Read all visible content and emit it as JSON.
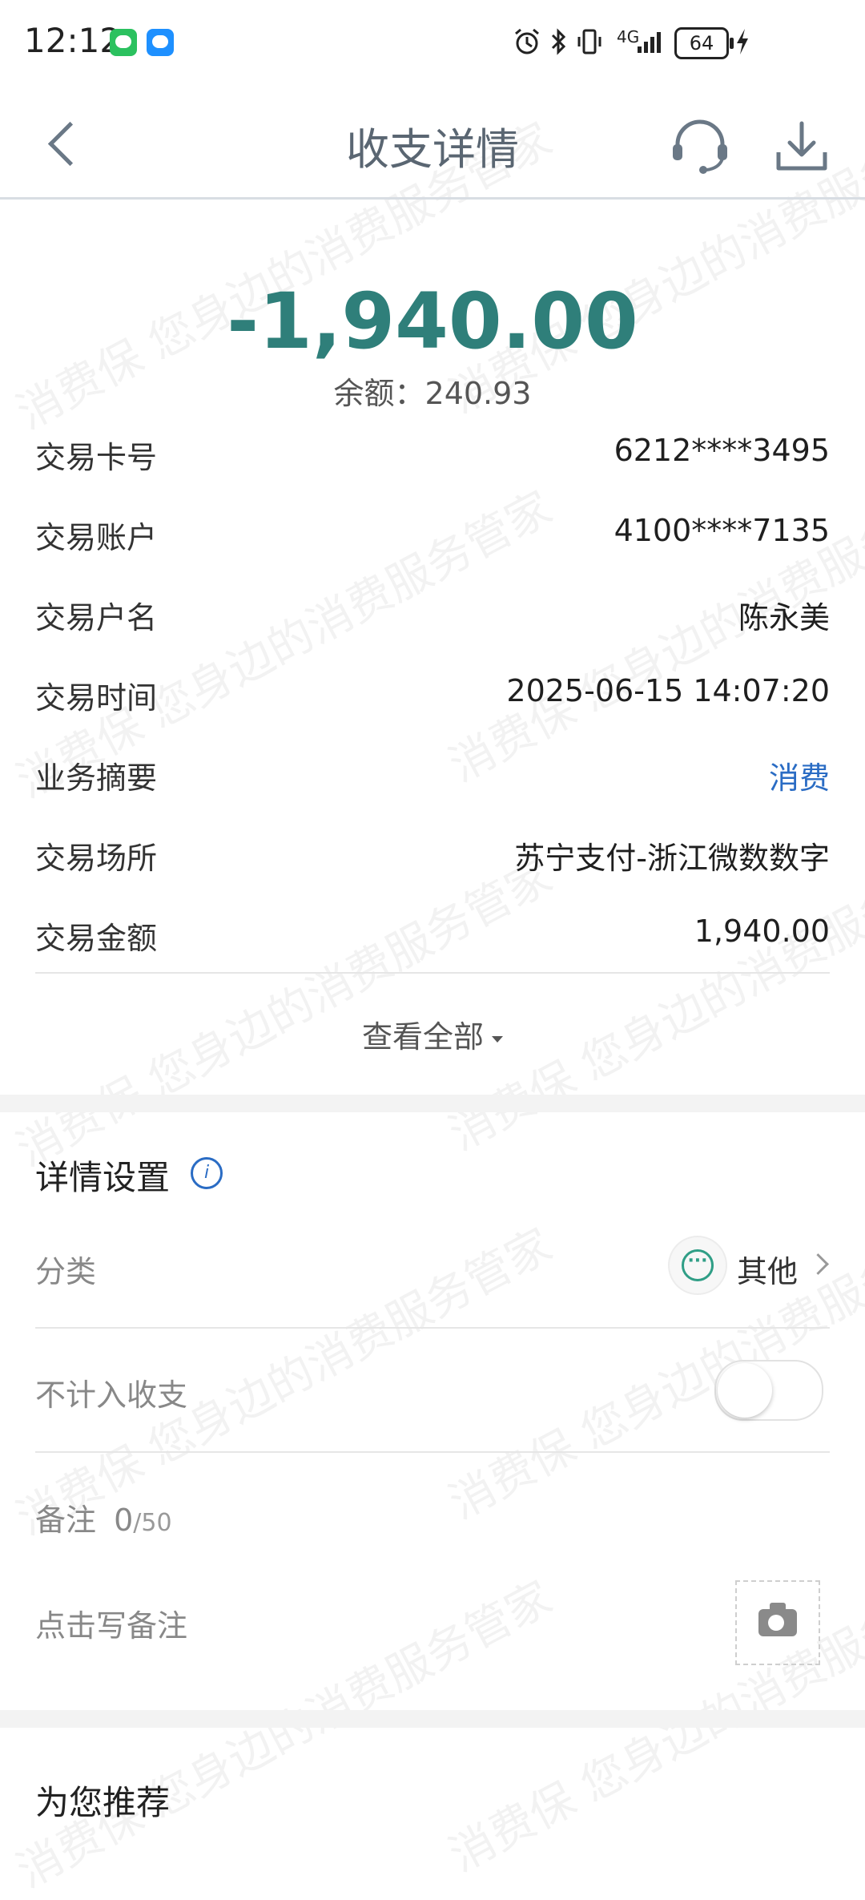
{
  "status_bar": {
    "time": "12:12",
    "network": "4G",
    "battery": "64",
    "icons": [
      "wechat-icon",
      "message-icon",
      "alarm-icon",
      "bluetooth-icon",
      "vibrate-icon",
      "signal-icon",
      "battery-icon",
      "charging-icon"
    ]
  },
  "header": {
    "title": "收支详情",
    "icons": [
      "back-icon",
      "customer-service-icon",
      "download-icon"
    ]
  },
  "summary": {
    "amount": "-1,940.00",
    "balance": "余额：240.93"
  },
  "details": [
    {
      "label": "交易卡号",
      "value": "6212****3495"
    },
    {
      "label": "交易账户",
      "value": "4100****7135"
    },
    {
      "label": "交易户名",
      "value": "陈永美"
    },
    {
      "label": "交易时间",
      "value": "2025-06-15 14:07:20"
    },
    {
      "label": "业务摘要",
      "value": "消费"
    },
    {
      "label": "交易场所",
      "value": "苏宁支付-浙江微数数字"
    },
    {
      "label": "交易金额",
      "value": "1,940.00"
    }
  ],
  "view_all": "查看全部",
  "settings": {
    "title": "详情设置",
    "category_label": "分类",
    "category_value": "其他",
    "exclude_label": "不计入收支",
    "exclude_enabled": false,
    "note_label": "备注",
    "note_count": "0",
    "note_max": "/50",
    "note_placeholder": "点击写备注"
  },
  "recommend": {
    "title": "为您推荐"
  },
  "watermark": "消费保 您身边的消费服务管家",
  "colors": {
    "amount": "#2f7f7a",
    "link_blue": "#2a6cc4",
    "category_icon": "#2f9e86"
  }
}
